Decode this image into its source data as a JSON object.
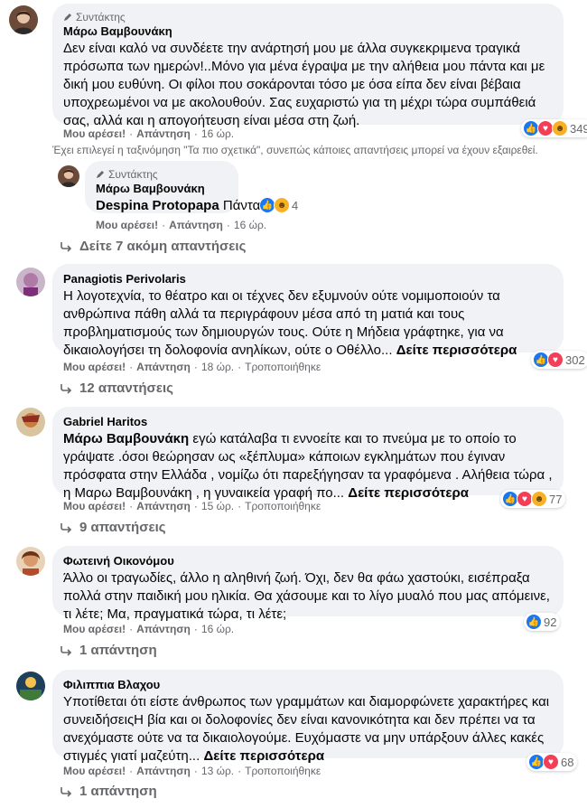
{
  "comments": [
    {
      "author_badge": "Συντάκτης",
      "name": "Μάρω Βαμβουνάκη",
      "text": "Δεν είναι καλό να συνδέετε την ανάρτησή μου με άλλα συγκεκριμενα τραγικά πρόσωπα των ημερών!..Μόνο για μένα έγραψα με την αλήθεια μου πάντα και με δική μου ευθύνη. Οι φίλοι που σοκάρονται τόσο με όσα είπα δεν είναι βέβαια υποχρεωμένοι να με ακολουθούν. Σας ευχαριστώ για τη μέχρι τώρα συμπάθειά σας, αλλά και η απογοήτευση είναι μέσα στη ζωή.",
      "like": "Μου αρέσει!",
      "reply": "Απάντηση",
      "time": "16 ώρ.",
      "reaction_count": "349",
      "reaction_icons": [
        "like-reaction-icon",
        "love-reaction-icon",
        "haha-reaction-icon"
      ]
    },
    {
      "author_badge": "Συντάκτης",
      "name": "Μάρω Βαμβουνάκη",
      "mention": "Despina Protopapa",
      "text": "Πάντα!",
      "like": "Μου αρέσει!",
      "reply": "Απάντηση",
      "time": "16 ώρ.",
      "reaction_count": "4",
      "reaction_icons": [
        "like-reaction-icon",
        "haha-reaction-icon"
      ]
    },
    {
      "name": "Panagiotis Perivolaris",
      "text": "Η λογοτεχνία, το θέατρο και οι τέχνες δεν εξυμνούν ούτε νομιμοποιούν τα ανθρώπινα πάθη αλλά τα περιγράφουν μέσα από τη ματιά και τους προβληματισμούς των δημιουργών τους. Ούτε η Μήδεια γράφτηκε, για να δικαιολογήσει τη δολοφονία ανηλίκων, ούτε ο Οθέλλο...",
      "see_more": "Δείτε περισσότερα",
      "like": "Μου αρέσει!",
      "reply": "Απάντηση",
      "time": "18 ώρ.",
      "edited": "Τροποποιήθηκε",
      "reaction_count": "302",
      "reaction_icons": [
        "like-reaction-icon",
        "love-reaction-icon"
      ],
      "replies": "12 απαντήσεις"
    },
    {
      "name": "Gabriel Haritos",
      "mention": "Μάρω Βαμβουνάκη",
      "text": "εγώ κατάλαβα τι εννοείτε και το πνεύμα με το οποίο το γράψατε .όσοι θεώρησαν ως «ξέπλυμα» κάποιων εγκλημάτων που έγιναν πρόσφατα στην Ελλάδα , νομίζω ότι παρεξήγησαν τα γραφόμενα . Αλήθεια τώρα , η Μαρω Βαμβουνάκη , η γυναικεία γραφή πο...",
      "see_more": "Δείτε περισσότερα",
      "like": "Μου αρέσει!",
      "reply": "Απάντηση",
      "time": "15 ώρ.",
      "edited": "Τροποποιήθηκε",
      "reaction_count": "77",
      "reaction_icons": [
        "like-reaction-icon",
        "love-reaction-icon",
        "haha-reaction-icon"
      ],
      "replies": "9 απαντήσεις"
    },
    {
      "name": "Φωτεινή Οικονόμου",
      "text": "Άλλο οι τραγωδίες, άλλο η αληθινή ζωή. Όχι, δεν θα φάω χαστούκι, εισέπραξα πολλά στην παιδική μου ηλικία. Θα χάσουμε και το λίγο μυαλό που μας απόμεινε, τι λέτε; Μα, πραγματικά τώρα, τι λέτε;",
      "like": "Μου αρέσει!",
      "reply": "Απάντηση",
      "time": "16 ώρ.",
      "reaction_count": "92",
      "reaction_icons": [
        "like-reaction-icon"
      ],
      "replies": "1 απάντηση"
    },
    {
      "name": "Φιλιππια Βλαχου",
      "text": "Υποτίθεται ότι είστε άνθρωπος των γραμμάτων και διαμορφώνετε χαρακτήρες και συνειδήσειςΗ βία και οι δολοφονίες δεν είναι κανονικότητα και δεν πρέπει να τα ανεχόμαστε ούτε να τα δικαιολογούμε. Ευχόμαστε να μην υπάρξουν άλλες κακές στιγμές γιατί μαζεύτη...",
      "see_more": "Δείτε περισσότερα",
      "like": "Μου αρέσει!",
      "reply": "Απάντηση",
      "time": "13 ώρ.",
      "edited": "Τροποποιήθηκε",
      "reaction_count": "68",
      "reaction_icons": [
        "like-reaction-icon",
        "love-reaction-icon"
      ],
      "replies": "1 απάντηση"
    }
  ],
  "sort_note": "Έχει επιλεγεί η ταξινόμηση \"Τα πιο σχετικά\", συνεπώς κάποιες απαντήσεις μπορεί να έχουν εξαιρεθεί.",
  "view_more_replies": "Δείτε 7 ακόμη απαντήσεις",
  "colors": {
    "bubble": "#f0f2f5",
    "secondary_text": "#65676b",
    "like_blue": "#1877f2",
    "love_red": "#f33e58",
    "haha_yellow": "#f7b125"
  }
}
